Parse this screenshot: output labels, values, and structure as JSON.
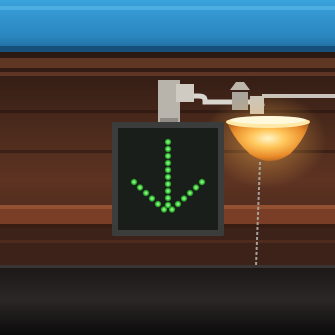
{
  "scene": {
    "subject": "lane-control-sign",
    "signal_state": "green-down-arrow",
    "colors": {
      "canopy": "#2c8fc8",
      "canopy_shadow": "#1b5f8f",
      "wood_ceiling": "#4a2a1c",
      "wood_mid": "#6a3a26",
      "beam": "#8a4a30",
      "sign_face": "#1a1f1b",
      "sign_frame": "#3a3a3a",
      "led_green": "#4dde4a",
      "lamp_glow": "#ffb840",
      "lamp_hot": "#fff2b0",
      "dark_lower": "#141212"
    },
    "led_column_count": 10
  }
}
